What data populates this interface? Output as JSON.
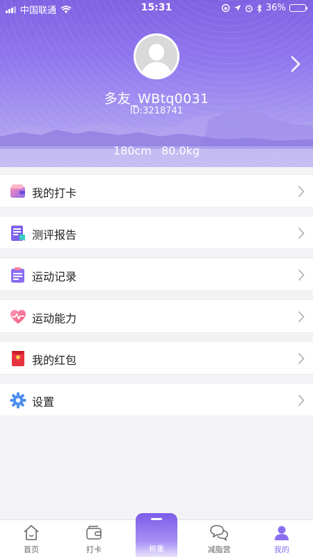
{
  "status_bar": {
    "carrier": "中国联通",
    "time": "15:31",
    "battery": "36%",
    "battery_level": 0.36
  },
  "profile": {
    "nickname": "多友_WBtq0031",
    "id": "ID:3218741",
    "height": "180cm",
    "weight": "80.0kg"
  },
  "menu": {
    "items": [
      {
        "label": "我的打卡",
        "icon": "wallet-icon"
      },
      {
        "label": "测评报告",
        "icon": "report-icon"
      },
      {
        "label": "运动记录",
        "icon": "clipboard-icon"
      },
      {
        "label": "运动能力",
        "icon": "heart-pulse-icon"
      },
      {
        "label": "我的红包",
        "icon": "red-envelope-icon"
      },
      {
        "label": "设置",
        "icon": "settings-gear-icon"
      }
    ]
  },
  "tabbar": {
    "tabs": [
      {
        "label": "首页",
        "icon": "home-icon"
      },
      {
        "label": "打卡",
        "icon": "wallet-icon"
      },
      {
        "label": "称重",
        "icon": "scale-icon"
      },
      {
        "label": "减脂营",
        "icon": "chat-bubbles-icon"
      },
      {
        "label": "我的",
        "icon": "person-icon"
      }
    ],
    "active_index": 4
  },
  "colors": {
    "accent": "#8a6ff0",
    "header_top": "#7f62e2",
    "background": "#f3f3f5"
  }
}
